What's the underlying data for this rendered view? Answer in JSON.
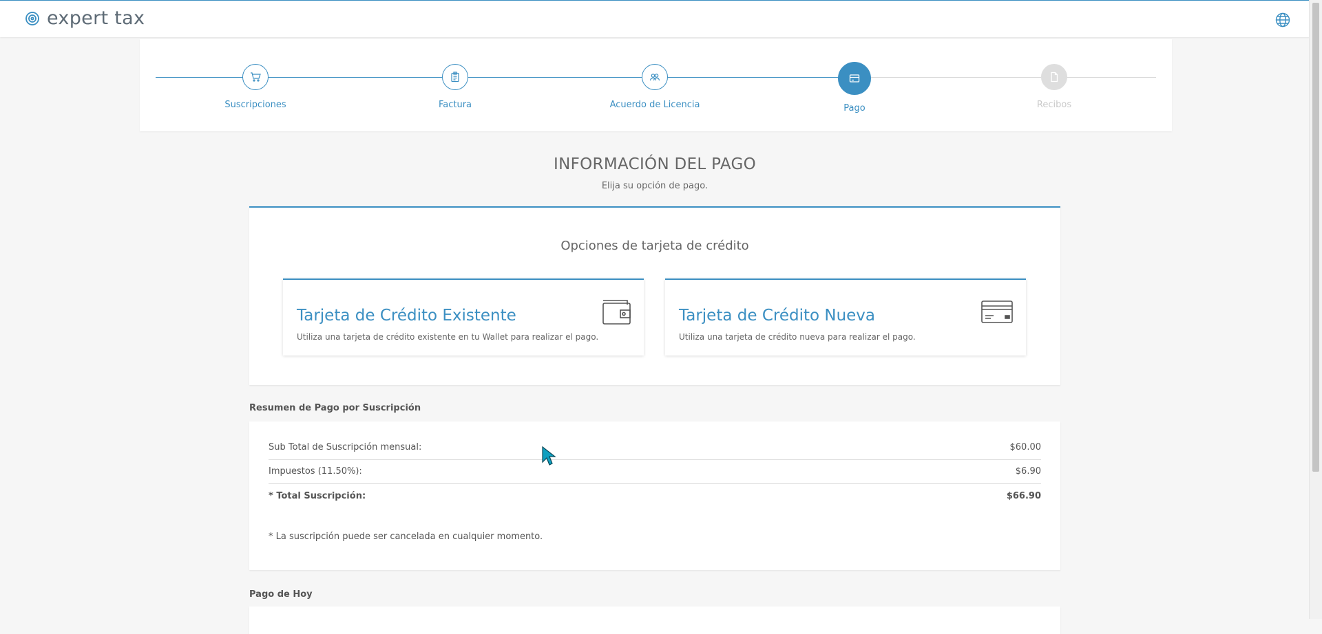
{
  "header": {
    "brand": "expert tax",
    "logo_icon": "swirl-logo-icon",
    "language_icon": "globe-icon"
  },
  "stepper": {
    "steps": [
      {
        "label": "Suscripciones",
        "icon": "cart-icon",
        "state": "completed"
      },
      {
        "label": "Factura",
        "icon": "clipboard-icon",
        "state": "completed"
      },
      {
        "label": "Acuerdo de Licencia",
        "icon": "handshake-icon",
        "state": "completed"
      },
      {
        "label": "Pago",
        "icon": "credit-card-icon",
        "state": "active"
      },
      {
        "label": "Recibos",
        "icon": "document-icon",
        "state": "disabled"
      }
    ]
  },
  "payment": {
    "title": "INFORMACIÓN DEL PAGO",
    "subtitle": "Elija su opción de pago.",
    "options_title": "Opciones de tarjeta de crédito",
    "existing": {
      "title": "Tarjeta de Crédito Existente",
      "description": "Utiliza una tarjeta de crédito existente en tu Wallet para realizar el pago.",
      "icon": "wallet-icon"
    },
    "new": {
      "title": "Tarjeta de Crédito Nueva",
      "description": "Utiliza una tarjeta de crédito nueva para realizar el pago.",
      "icon": "credit-card-icon"
    }
  },
  "summary": {
    "heading": "Resumen de Pago por Suscripción",
    "rows": [
      {
        "label": "Sub Total de Suscripción mensual:",
        "value": "$60.00"
      },
      {
        "label": "Impuestos (11.50%):",
        "value": "$6.90"
      },
      {
        "label": "* Total Suscripción:",
        "value": "$66.90"
      }
    ],
    "note": "* La suscripción puede ser cancelada en cualquier momento."
  },
  "today": {
    "heading": "Pago de Hoy"
  },
  "colors": {
    "accent": "#3b8fc2",
    "disabled": "#dedede",
    "background": "#f6f6f6"
  }
}
